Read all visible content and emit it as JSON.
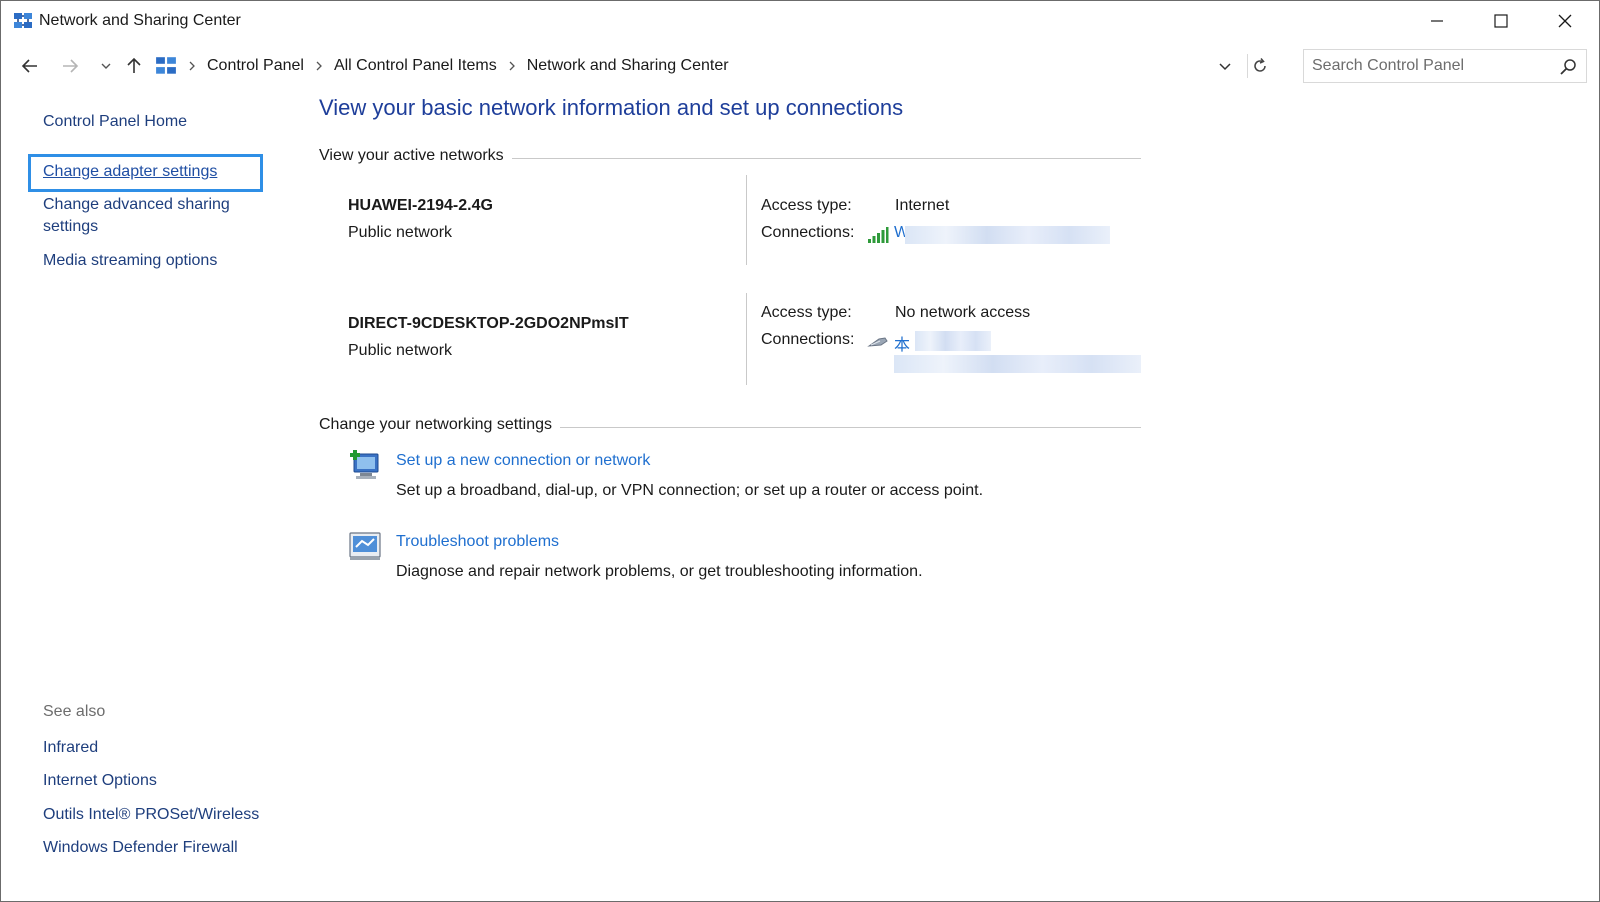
{
  "window": {
    "title": "Network and Sharing Center"
  },
  "address": {
    "crumbs": [
      "Control Panel",
      "All Control Panel Items",
      "Network and Sharing Center"
    ],
    "search_placeholder": "Search Control Panel"
  },
  "sidebar": {
    "home": "Control Panel Home",
    "items": [
      {
        "label": "Change adapter settings",
        "selected": true
      },
      {
        "label": "Change advanced sharing settings"
      },
      {
        "label": "Media streaming options"
      }
    ],
    "see_also_title": "See also",
    "see_also": [
      "Infrared",
      "Internet Options",
      "Outils Intel® PROSet/Wireless",
      "Windows Defender Firewall"
    ]
  },
  "main": {
    "title": "View your basic network information and set up connections",
    "active_networks_heading": "View your active networks",
    "networks": [
      {
        "name": "HUAWEI-2194-2.4G",
        "category": "Public network",
        "access_type_label": "Access type:",
        "access_type": "Internet",
        "connections_label": "Connections:",
        "connection_icon": "wifi-signal-icon",
        "connection_name": "W"
      },
      {
        "name": "DIRECT-9CDESKTOP-2GDO2NPmsIT",
        "category": "Public network",
        "access_type_label": "Access type:",
        "access_type": "No network access",
        "connections_label": "Connections:",
        "connection_icon": "ethernet-cable-icon",
        "connection_name": "本"
      }
    ],
    "settings_heading": "Change your networking settings",
    "tasks": [
      {
        "icon": "new-connection-icon",
        "link": "Set up a new connection or network",
        "description": "Set up a broadband, dial-up, or VPN connection; or set up a router or access point."
      },
      {
        "icon": "troubleshoot-icon",
        "link": "Troubleshoot problems",
        "description": "Diagnose and repair network problems, or get troubleshooting information."
      }
    ]
  },
  "colors": {
    "link": "#1f6fcf",
    "title": "#1e3e9a",
    "focus_ring": "#2f8fe6"
  }
}
